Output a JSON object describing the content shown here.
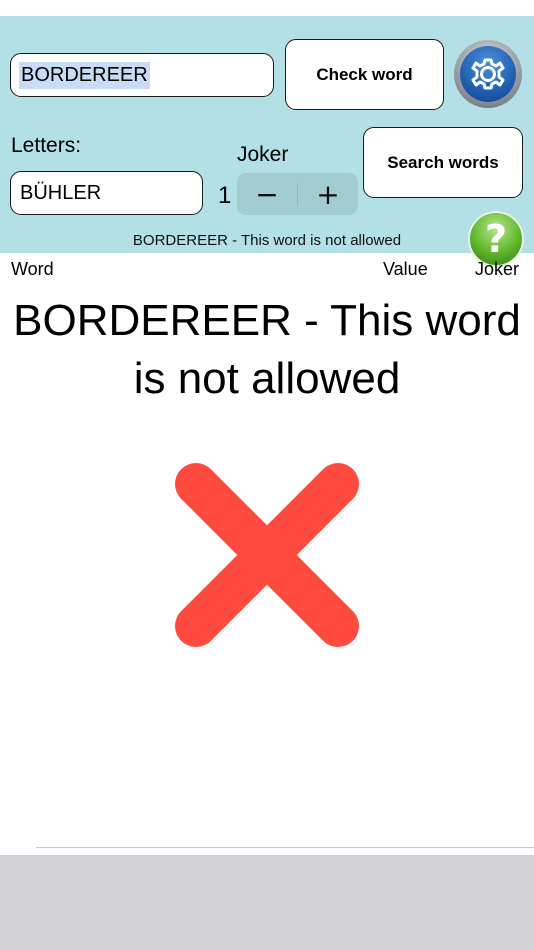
{
  "word_input": {
    "value": "BORDEREER"
  },
  "buttons": {
    "check_word": "Check word",
    "search_words": "Search words"
  },
  "icons": {
    "settings": "gear-icon",
    "help": "question-icon",
    "result": "x-mark-icon"
  },
  "letters": {
    "label": "Letters:",
    "value": "BÜHLER"
  },
  "joker": {
    "label": "Joker",
    "count": "1",
    "decrement": "−",
    "increment": "+"
  },
  "status": "BORDEREER - This word is not allowed",
  "help_symbol": "?",
  "columns": {
    "word": "Word",
    "value": "Value",
    "joker": "Joker"
  },
  "result": {
    "message": "BORDEREER - This word is not allowed"
  },
  "colors": {
    "panel_bg": "#b3e0e6",
    "stepper_bg": "#a3ccd2",
    "x_mark": "#ff4a40",
    "bottom_bar": "#d1d1d6"
  }
}
